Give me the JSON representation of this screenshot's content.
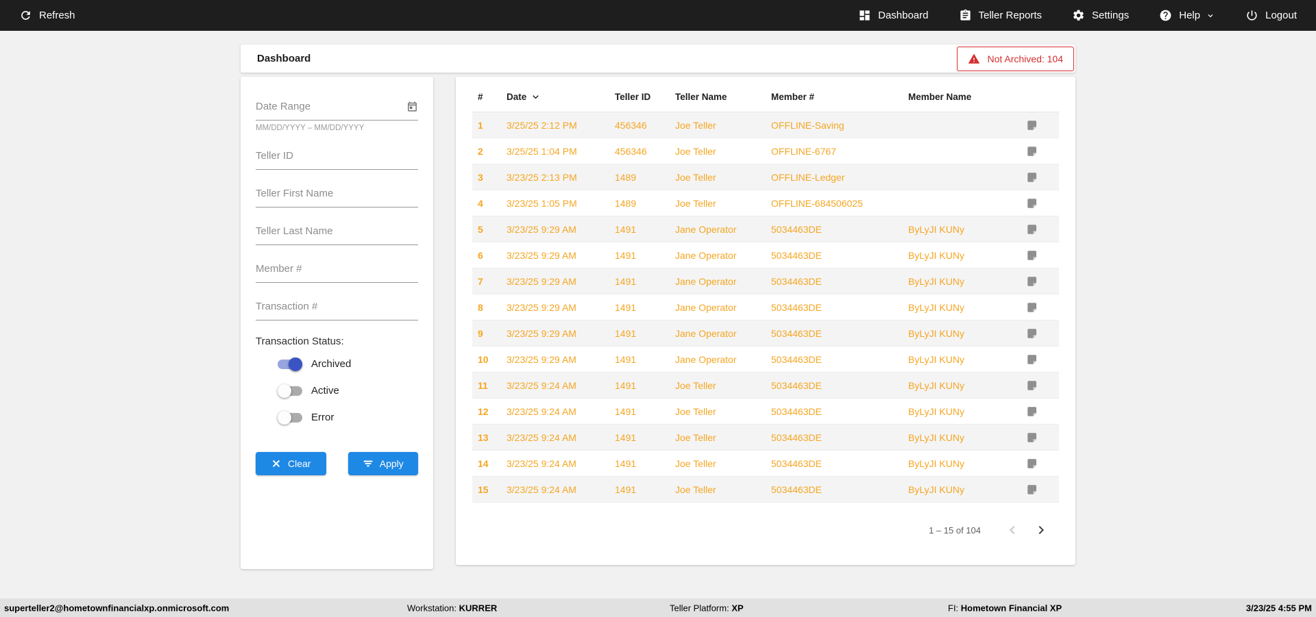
{
  "topbar": {
    "refresh_label": "Refresh",
    "nav": [
      {
        "label": "Dashboard",
        "icon": "dashboard-grid"
      },
      {
        "label": "Teller Reports",
        "icon": "clipboard"
      },
      {
        "label": "Settings",
        "icon": "gear"
      },
      {
        "label": "Help",
        "icon": "question-circle"
      },
      {
        "label": "Logout",
        "icon": "power"
      }
    ]
  },
  "header": {
    "title": "Dashboard",
    "badge": "Not Archived: 104"
  },
  "filters": {
    "date_range_placeholder": "Date Range",
    "date_range_helper": "MM/DD/YYYY – MM/DD/YYYY",
    "teller_id_placeholder": "Teller ID",
    "teller_first_placeholder": "Teller First Name",
    "teller_last_placeholder": "Teller Last Name",
    "member_placeholder": "Member #",
    "transaction_placeholder": "Transaction #",
    "status_label": "Transaction Status:",
    "toggles": [
      {
        "label": "Archived",
        "on": true
      },
      {
        "label": "Active",
        "on": false
      },
      {
        "label": "Error",
        "on": false
      }
    ],
    "clear_label": "Clear",
    "apply_label": "Apply"
  },
  "table": {
    "columns": [
      "#",
      "Date",
      "Teller ID",
      "Teller Name",
      "Member #",
      "Member Name"
    ],
    "rows": [
      {
        "num": "1",
        "date": "3/25/25 2:12 PM",
        "teller_id": "456346",
        "teller_name": "Joe Teller",
        "member": "OFFLINE-Saving",
        "member_name": ""
      },
      {
        "num": "2",
        "date": "3/25/25 1:04 PM",
        "teller_id": "456346",
        "teller_name": "Joe Teller",
        "member": "OFFLINE-6767",
        "member_name": ""
      },
      {
        "num": "3",
        "date": "3/23/25 2:13 PM",
        "teller_id": "1489",
        "teller_name": "Joe Teller",
        "member": "OFFLINE-Ledger",
        "member_name": ""
      },
      {
        "num": "4",
        "date": "3/23/25 1:05 PM",
        "teller_id": "1489",
        "teller_name": "Joe Teller",
        "member": "OFFLINE-684506025",
        "member_name": ""
      },
      {
        "num": "5",
        "date": "3/23/25 9:29 AM",
        "teller_id": "1491",
        "teller_name": "Jane Operator",
        "member": "5034463DE",
        "member_name": "ByLyJI KUNy"
      },
      {
        "num": "6",
        "date": "3/23/25 9:29 AM",
        "teller_id": "1491",
        "teller_name": "Jane Operator",
        "member": "5034463DE",
        "member_name": "ByLyJI KUNy"
      },
      {
        "num": "7",
        "date": "3/23/25 9:29 AM",
        "teller_id": "1491",
        "teller_name": "Jane Operator",
        "member": "5034463DE",
        "member_name": "ByLyJI KUNy"
      },
      {
        "num": "8",
        "date": "3/23/25 9:29 AM",
        "teller_id": "1491",
        "teller_name": "Jane Operator",
        "member": "5034463DE",
        "member_name": "ByLyJI KUNy"
      },
      {
        "num": "9",
        "date": "3/23/25 9:29 AM",
        "teller_id": "1491",
        "teller_name": "Jane Operator",
        "member": "5034463DE",
        "member_name": "ByLyJI KUNy"
      },
      {
        "num": "10",
        "date": "3/23/25 9:29 AM",
        "teller_id": "1491",
        "teller_name": "Jane Operator",
        "member": "5034463DE",
        "member_name": "ByLyJI KUNy"
      },
      {
        "num": "11",
        "date": "3/23/25 9:24 AM",
        "teller_id": "1491",
        "teller_name": "Joe Teller",
        "member": "5034463DE",
        "member_name": "ByLyJI KUNy"
      },
      {
        "num": "12",
        "date": "3/23/25 9:24 AM",
        "teller_id": "1491",
        "teller_name": "Joe Teller",
        "member": "5034463DE",
        "member_name": "ByLyJI KUNy"
      },
      {
        "num": "13",
        "date": "3/23/25 9:24 AM",
        "teller_id": "1491",
        "teller_name": "Joe Teller",
        "member": "5034463DE",
        "member_name": "ByLyJI KUNy"
      },
      {
        "num": "14",
        "date": "3/23/25 9:24 AM",
        "teller_id": "1491",
        "teller_name": "Joe Teller",
        "member": "5034463DE",
        "member_name": "ByLyJI KUNy"
      },
      {
        "num": "15",
        "date": "3/23/25 9:24 AM",
        "teller_id": "1491",
        "teller_name": "Joe Teller",
        "member": "5034463DE",
        "member_name": "ByLyJI KUNy"
      }
    ],
    "pagination": "1 – 15 of 104"
  },
  "footer": {
    "email": "superteller2@hometownfinancialxp.onmicrosoft.com",
    "workstation_label": "Workstation:",
    "workstation_value": "KURRER",
    "platform_label": "Teller Platform:",
    "platform_value": "XP",
    "fi_label": "FI:",
    "fi_value": "Hometown Financial XP",
    "datetime": "3/23/25 4:55 PM"
  },
  "colors": {
    "accent_blue": "#1E88E5",
    "row_orange": "#F5A623",
    "alert_red": "#D32F2F",
    "toggle_on_blue": "#3B54C4",
    "topbar_bg": "#1E1E1E"
  }
}
